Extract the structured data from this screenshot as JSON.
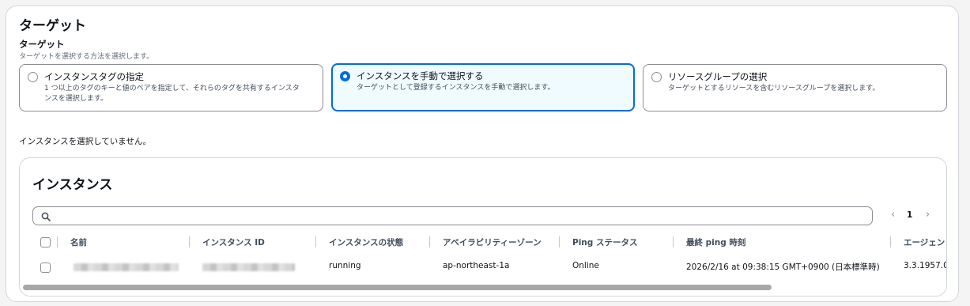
{
  "section": {
    "title": "ターゲット",
    "field_label": "ターゲット",
    "field_description": "ターゲットを選択する方法を選択します。"
  },
  "target_options": [
    {
      "title": "インスタンスタグの指定",
      "description": "1 つ以上のタグのキーと値のペアを指定して、それらのタグを共有するインスタンスを選択します。",
      "selected": false
    },
    {
      "title": "インスタンスを手動で選択する",
      "description": "ターゲットとして登録するインスタンスを手動で選択します。",
      "selected": true
    },
    {
      "title": "リソースグループの選択",
      "description": "ターゲットとするリソースを含むリソースグループを選択します。",
      "selected": false
    }
  ],
  "status_message": "インスタンスを選択していません。",
  "instances": {
    "title": "インスタンス",
    "search": {
      "value": "",
      "placeholder": ""
    },
    "pagination": {
      "current_page": "1"
    },
    "columns": [
      "名前",
      "インスタンス ID",
      "インスタンスの状態",
      "アベイラビリティーゾーン",
      "Ping ステータス",
      "最終 ping 時刻",
      "エージェン"
    ],
    "rows": [
      {
        "name": "",
        "instance_id": "",
        "state": "running",
        "availability_zone": "ap-northeast-1a",
        "ping_status": "Online",
        "last_ping": "2026/2/16 at 09:38:15 GMT+0900 (日本標準時)",
        "agent_version": "3.3.1957.0"
      }
    ]
  },
  "colors": {
    "accent": "#006ce0",
    "selected_bg": "#f0fbff",
    "border": "#8c8c94"
  }
}
